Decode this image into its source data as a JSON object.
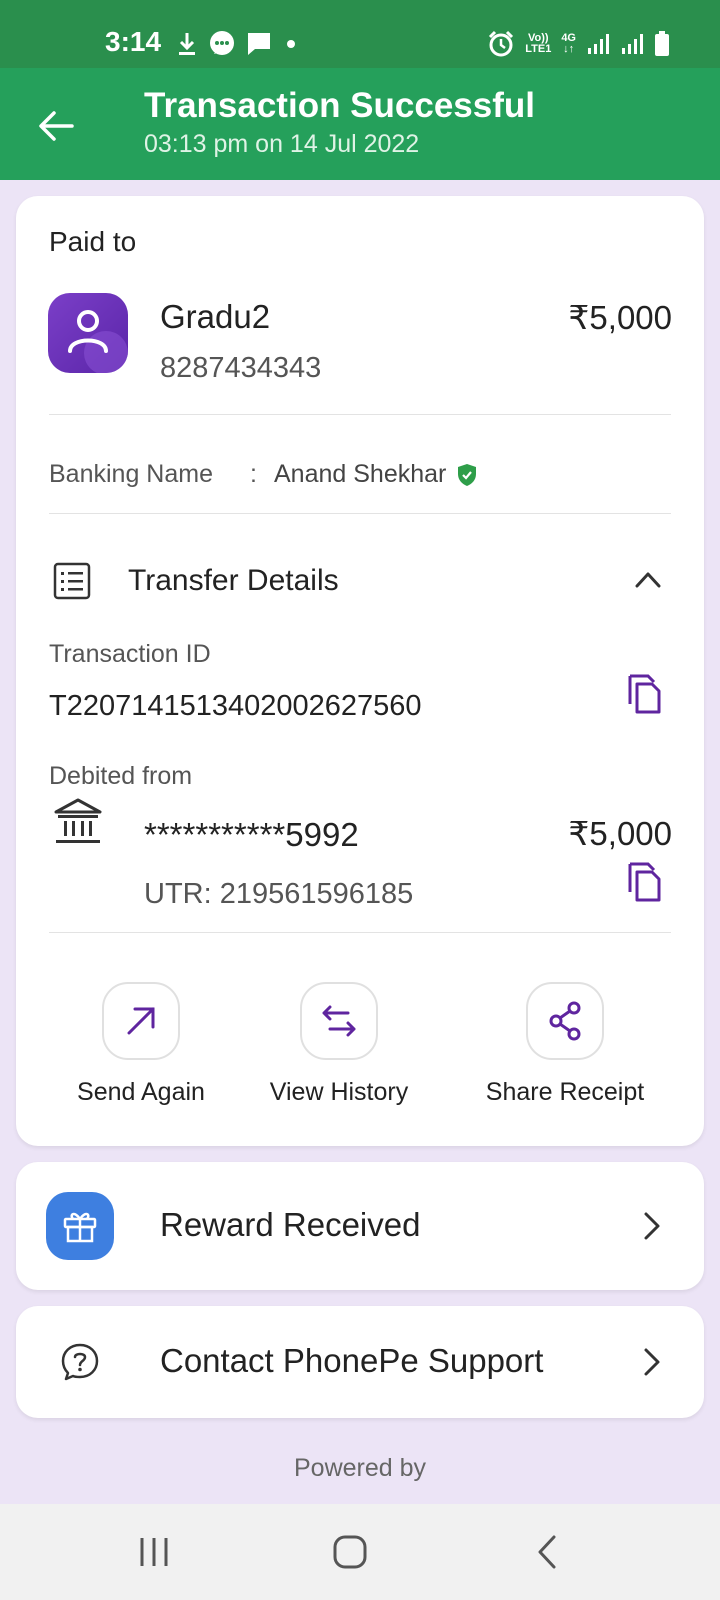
{
  "status_bar": {
    "time": "3:14",
    "icons_left": [
      "download-icon",
      "chat-icon",
      "message-icon",
      "dot-icon"
    ],
    "network_vo": "Vo))",
    "network_lte": "LTE1",
    "network_4g": "4G",
    "icons_right": [
      "alarm-icon",
      "signal-icon",
      "signal-icon",
      "battery-icon"
    ]
  },
  "header": {
    "title": "Transaction Successful",
    "subtitle": "03:13 pm on 14 Jul 2022",
    "back_icon": "back-arrow-icon"
  },
  "paid_to": {
    "label": "Paid to",
    "name": "Gradu2",
    "number": "8287434343",
    "amount": "₹5,000",
    "avatar_icon": "user-icon"
  },
  "banking": {
    "label": "Banking Name",
    "colon": ":",
    "value": "Anand Shekhar",
    "verified_icon": "verified-shield-icon"
  },
  "transfer_details": {
    "title": "Transfer Details",
    "transaction_id_label": "Transaction ID",
    "transaction_id": "T2207141513402002627560",
    "debited_from_label": "Debited from",
    "account": "***********5992",
    "amount": "₹5,000",
    "utr": "UTR: 219561596185"
  },
  "actions": [
    {
      "label": "Send Again",
      "icon": "arrow-up-right-icon"
    },
    {
      "label": "View History",
      "icon": "swap-arrows-icon"
    },
    {
      "label": "Share Receipt",
      "icon": "share-icon"
    }
  ],
  "reward": {
    "label": "Reward Received",
    "icon": "gift-icon"
  },
  "support": {
    "label": "Contact PhonePe Support",
    "icon": "help-icon"
  },
  "footer": {
    "powered_by": "Powered by"
  },
  "colors": {
    "status_bar": "#2a8f4d",
    "app_bar": "#25a05b",
    "background": "#ece4f6",
    "accent_purple": "#5f259f",
    "reward_blue": "#3e7fe0",
    "verified_green": "#2e9e49"
  }
}
